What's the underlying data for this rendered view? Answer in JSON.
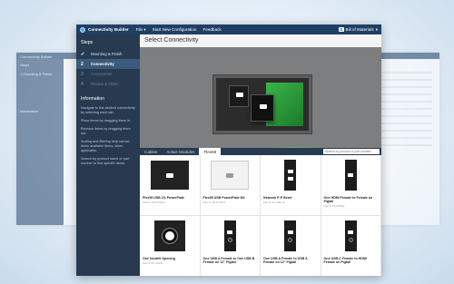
{
  "app": {
    "brand": "Connectivity Builder",
    "menu": [
      "File",
      "Start New Configuration",
      "Feedback"
    ],
    "bom_count": "3",
    "bom_label": "Bill of Materials",
    "bom_caret": "▾",
    "file_caret": "▾"
  },
  "bg_left": {
    "title": "Connectivity Builder",
    "steps": "Steps",
    "step1": "1  Mounting & Finish",
    "info": "Information"
  },
  "sidebar": {
    "title": "Steps",
    "steps": [
      {
        "num": "✔",
        "label": "Mounting & Finish",
        "state": "done"
      },
      {
        "num": "2",
        "label": "Connectivity",
        "state": "active"
      },
      {
        "num": "3",
        "label": "Accessories",
        "state": "dim"
      },
      {
        "num": "4",
        "label": "Review & Order",
        "state": "dim"
      }
    ],
    "info_title": "Information",
    "info_paras": [
      "Navigate to the desired connectivity by selecting each tab.",
      "Place items by dragging them in.",
      "Remove items by dragging them out.",
      "Sorting and filtering help narrow down available items, when applicable.",
      "Search by product name or part number to find specific items."
    ]
  },
  "content": {
    "title": "Select Connectivity",
    "tabs": [
      "Cables",
      "Active Modules",
      "Flex55"
    ],
    "selected_tab": "Flex55",
    "search_placeholder": "Search by product or part number"
  },
  "products": [
    {
      "name": "Flex55 USB 2/1 PowerPlate",
      "part": "Part #: FD-FTWC2"
    },
    {
      "name": "Flex55 USB PowerPlate M2",
      "part": "Part #: FD-FTWC2"
    },
    {
      "name": "Network P-P Bezel",
      "part": "Part #: FLI-HB-12"
    },
    {
      "name": "One HDMI Female to Female on Pigtail",
      "part": "Part #: FLI-F0EQ"
    },
    {
      "name": "One Neutrik Opening",
      "part": "Part #: FLI-HN01"
    },
    {
      "name": "One USB A Female to One USB B Female on 12\" Pigtail",
      "part": ""
    },
    {
      "name": "One USB A Female to USB A Female on 12\" Pigtail",
      "part": ""
    },
    {
      "name": "One USB-C Female to HDMI Female on Pigtail",
      "part": ""
    }
  ]
}
